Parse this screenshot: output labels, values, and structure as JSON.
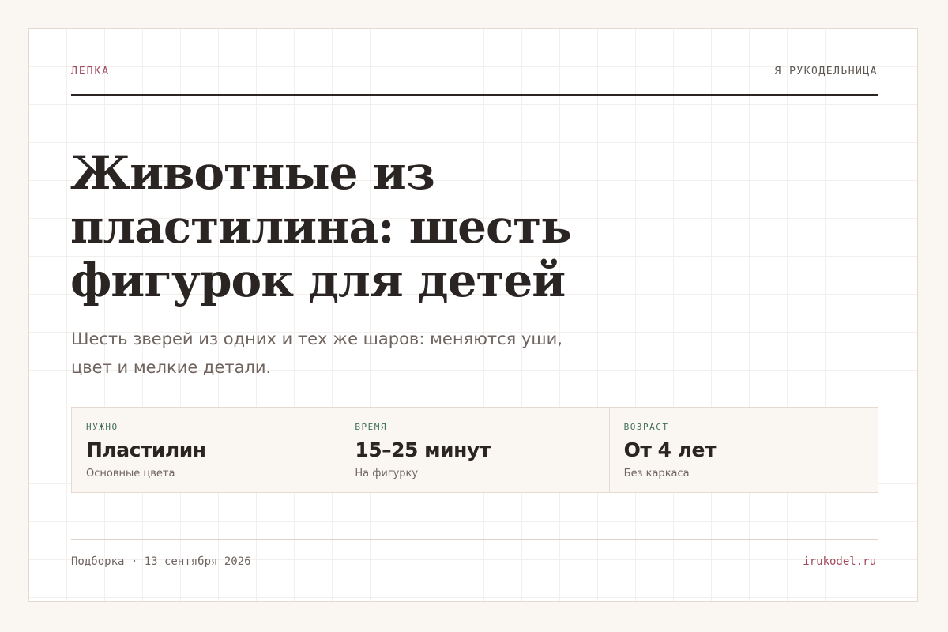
{
  "header": {
    "category": "ЛЕПКА",
    "brand": "Я РУКОДЕЛЬНИЦА"
  },
  "article": {
    "title": "Животные из пластилина: шесть фигурок для детей",
    "subtitle": "Шесть зверей из одних и тех же шаров: меняются уши, цвет и мелкие детали."
  },
  "facts": [
    {
      "label": "НУЖНО",
      "value": "Пластилин",
      "note": "Основные цвета"
    },
    {
      "label": "ВРЕМЯ",
      "value": "15–25 минут",
      "note": "На фигурку"
    },
    {
      "label": "ВОЗРАСТ",
      "value": "От 4 лет",
      "note": "Без каркаса"
    }
  ],
  "footer": {
    "meta": "Подборка · 13 сентября 2026",
    "site": "irukodel.ru"
  },
  "colors": {
    "accent": "#a24a5d",
    "label_green": "#3f6e5b",
    "text": "#2a2523",
    "muted": "#6f6460",
    "page_background": "#faf6f2"
  }
}
